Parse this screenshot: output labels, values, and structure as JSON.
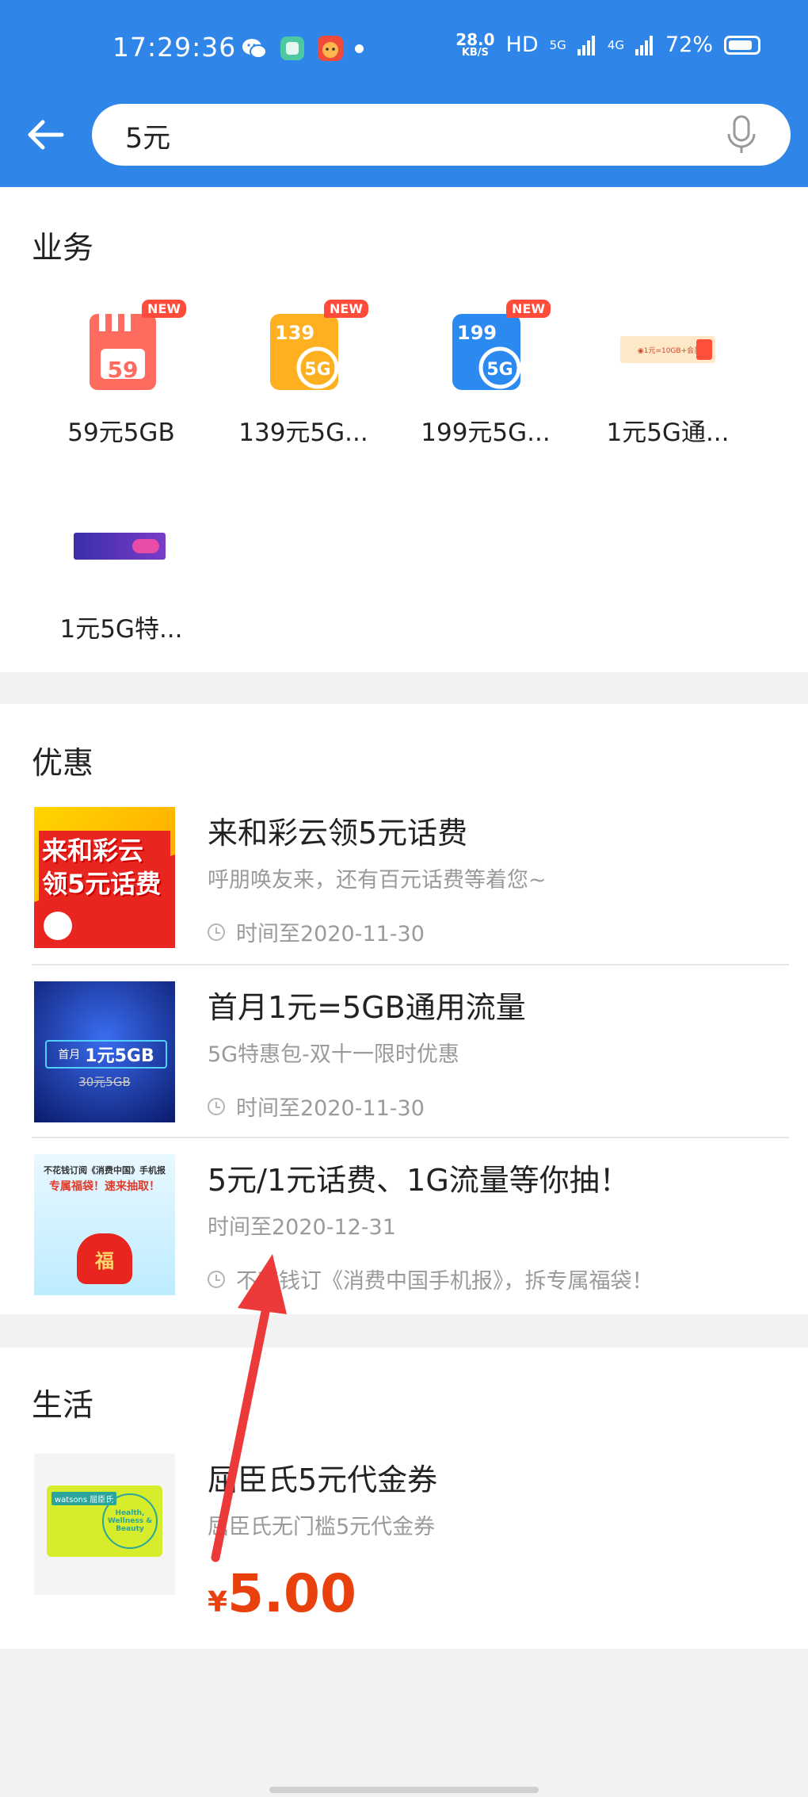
{
  "status_bar": {
    "time": "17:29:36",
    "net_speed": "28.0",
    "net_unit": "KB/S",
    "hd": "HD",
    "net1": "5G",
    "net2": "4G",
    "battery": "72%"
  },
  "search": {
    "value": "5元"
  },
  "sections": {
    "business": {
      "title": "业务",
      "items": [
        {
          "label": "59元5GB",
          "icon_text": "59",
          "badge": "NEW"
        },
        {
          "label": "139元5G...",
          "icon_text": "139",
          "badge": "NEW"
        },
        {
          "label": "199元5G...",
          "icon_text": "199",
          "badge": "NEW"
        },
        {
          "label": "1元5G通...",
          "banner_text": "◉1元=10GB+会员"
        },
        {
          "label": "1元5G特..."
        }
      ]
    },
    "offers": {
      "title": "优惠",
      "items": [
        {
          "title": "来和彩云领5元话费",
          "subtitle": "呼朋唤友来，还有百元话费等着您~",
          "time": "时间至2020-11-30",
          "thumb_text": "来和彩云 领5元话费"
        },
        {
          "title": "首月1元=5GB通用流量",
          "subtitle": "5G特惠包-双十一限时优惠",
          "time": "时间至2020-11-30",
          "thumb_prefix": "首月",
          "thumb_main": "1元5GB",
          "thumb_strike": "30元5GB"
        },
        {
          "title": "5元/1元话费、1G流量等你抽！",
          "subtitle": "时间至2020-12-31",
          "time": "不花钱订《消费中国手机报》，拆专属福袋！",
          "thumb_line1": "不花钱订阅《消费中国》手机报",
          "thumb_line2": "专属福袋！速来抽取！",
          "thumb_fu": "福"
        }
      ]
    },
    "life": {
      "title": "生活",
      "items": [
        {
          "title": "屈臣氏5元代金券",
          "subtitle": "屈臣氏无门槛5元代金券",
          "price_symbol": "¥",
          "price": "5.00",
          "card_brand": "watsons 屈臣氏",
          "card_text": "Health, Wellness & Beauty"
        }
      ]
    }
  },
  "colors": {
    "header_blue": "#2f86e8",
    "price_red": "#e8410e",
    "arrow_red": "#ec3a3a"
  }
}
